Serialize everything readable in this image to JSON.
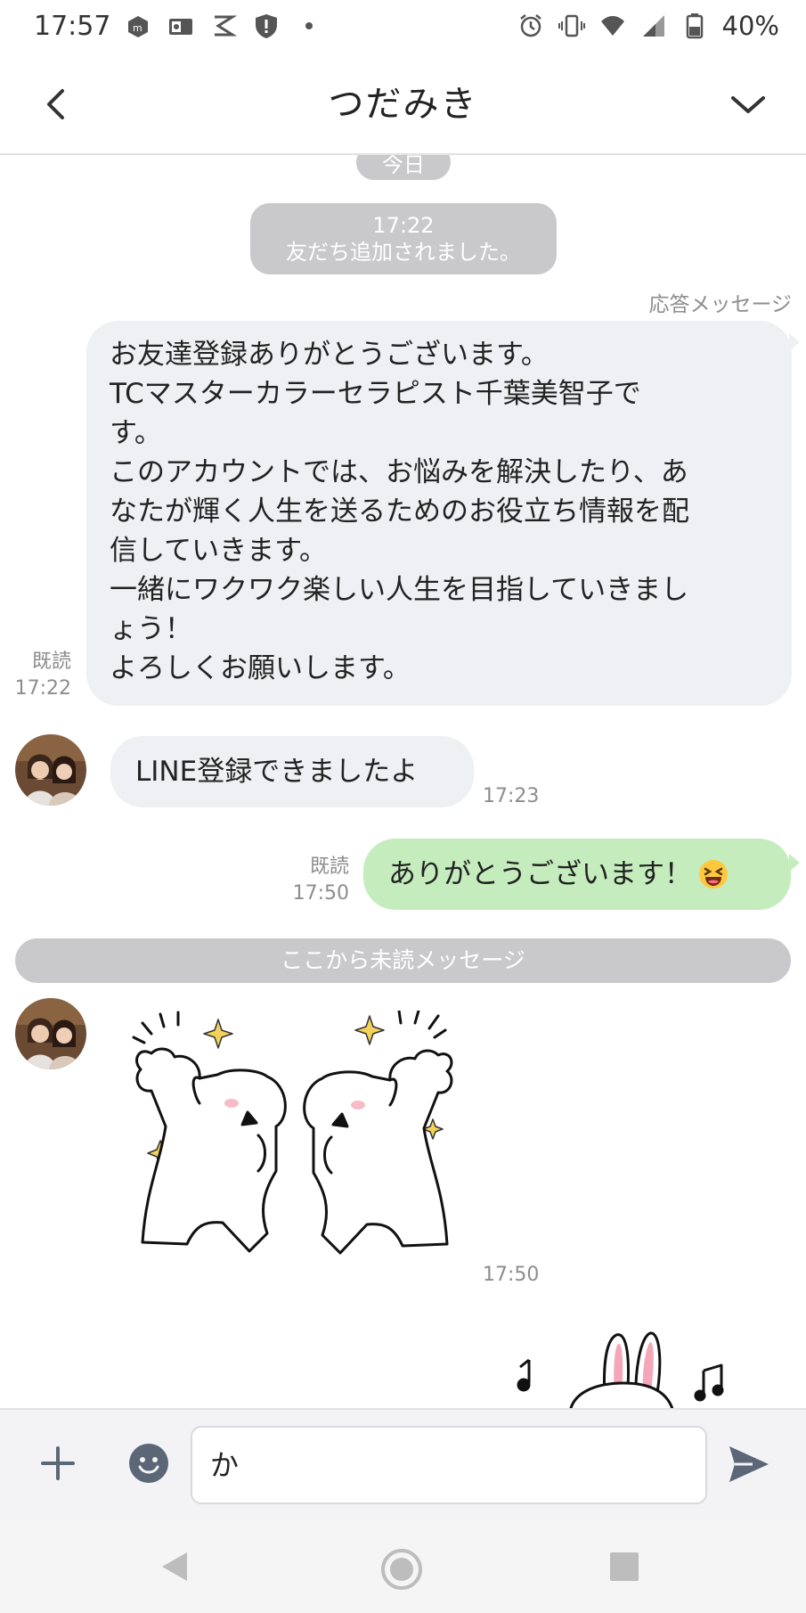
{
  "status_bar": {
    "time": "17:57",
    "battery": "40%",
    "icons": [
      "m-app-icon",
      "outlook-icon",
      "s-app-icon",
      "shield-icon",
      "dot-icon",
      "alarm-icon",
      "vibrate-icon",
      "wifi-icon",
      "signal-icon",
      "battery-icon"
    ]
  },
  "header": {
    "title": "つだみき",
    "back_icon": "chevron-left-icon",
    "menu_icon": "chevron-down-icon"
  },
  "chat": {
    "date_pill": "今日",
    "system_message": {
      "time": "17:22",
      "text": "友だち追加されました。"
    },
    "auto_reply_label": "応答メッセージ",
    "messages": [
      {
        "side": "right",
        "style": "gray",
        "text": "お友達登録ありがとうございます。\nTCマスターカラーセラピスト千葉美智子で\nす。\nこのアカウントでは、お悩みを解決したり、あ\nなたが輝く人生を送るためのお役立ち情報を配\n信していきます。\n一緒にワクワク楽しい人生を目指していきまし\nょう！\nよろしくお願いします。",
        "read": "既読",
        "time": "17:22"
      },
      {
        "side": "left",
        "style": "gray",
        "text": "LINE登録できましたよ",
        "time": "17:23"
      },
      {
        "side": "right",
        "style": "green",
        "text": "ありがとうございます！",
        "emoji": "😆",
        "read": "既読",
        "time": "17:50"
      }
    ],
    "unread_divider": "ここから未読メッセージ",
    "sticker_message": {
      "side": "left",
      "time": "17:50"
    }
  },
  "input_bar": {
    "value": "か",
    "plus_icon": "plus-icon",
    "emoji_icon": "emoji-icon",
    "send_icon": "send-icon"
  },
  "nav_bar": {
    "icons": [
      "nav-back-icon",
      "nav-home-icon",
      "nav-recents-icon"
    ]
  },
  "colors": {
    "green_bubble": "#c5ecbd",
    "gray_bubble": "#eef0f3",
    "system_pill": "#c9c9cb"
  }
}
